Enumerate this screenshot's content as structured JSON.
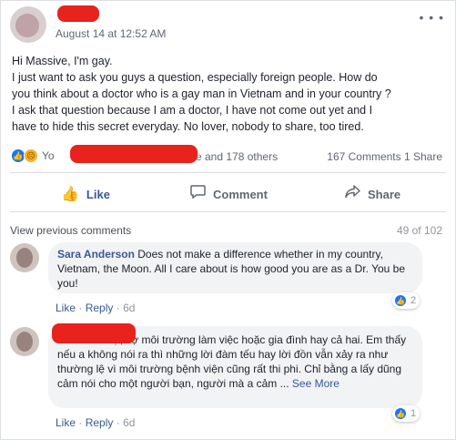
{
  "post": {
    "timestamp": "August 14 at 12:52 AM",
    "more_icon": "more-options-icon",
    "text_lines": [
      "Hi Massive, I'm gay.",
      "I just want to ask you guys a question, especially foreign people. How do",
      "you think about a doctor who is a gay man in Vietnam and in your country ?",
      "I ask that question because I am a doctor, I have not come out yet and I",
      "have to hide this secret everyday. No lover, nobody to share, too tired."
    ],
    "reactions": {
      "names_visible": "Yo",
      "names_tail": "e and 178 others",
      "icons": [
        "like-reaction-icon",
        "sad-reaction-icon"
      ]
    },
    "counts": "167 Comments  1 Share"
  },
  "actions": {
    "like": "Like",
    "comment": "Comment",
    "share": "Share"
  },
  "comments_header": {
    "view_previous": "View previous comments",
    "page_count": "49 of 102"
  },
  "comments": [
    {
      "author": "Sara Anderson",
      "text": "Does not make a difference whether in my country, Vietnam, the Moon. All I care about is how good you are as a Dr. You be you!",
      "like": "Like",
      "reply": "Reply",
      "age": "6d",
      "reaction_count": "2"
    },
    {
      "author": "",
      "text": "Chắc anh sợ, sợ môi trường làm việc hoặc gia đình hay cả hai. Em thấy nếu a không nói ra thì những lời đàm tếu hay lời đồn vẫn xảy ra như thường lệ vì môi trường bệnh viện cũng rất thi phi. Chỉ bằng a lấy dũng cảm nói cho một người bạn, người mà a cảm ...",
      "see_more": "See More",
      "like": "Like",
      "reply": "Reply",
      "age": "6d",
      "reaction_count": "1"
    }
  ],
  "colors": {
    "accent": "#385898",
    "like_blue": "#1877f2",
    "redaction": "#e8221c",
    "bubble": "#f2f3f5"
  }
}
